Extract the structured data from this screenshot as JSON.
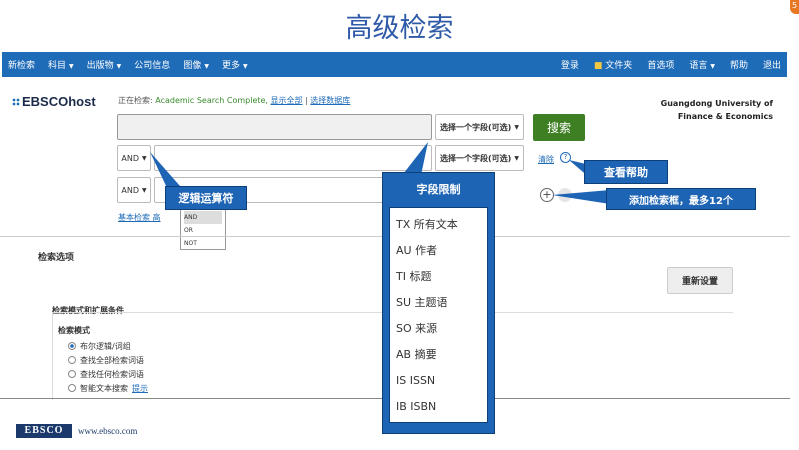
{
  "slide": {
    "title": "高级检索",
    "badge": "5"
  },
  "nav": {
    "left": [
      "新检索",
      "科目",
      "出版物",
      "公司信息",
      "图像",
      "更多"
    ],
    "right": [
      "登录",
      "文件夹",
      "首选项",
      "语言",
      "帮助",
      "退出"
    ]
  },
  "header": {
    "logo": "EBSCOhost",
    "searching_label": "正在检索: ",
    "database": "Academic Search Complete,",
    "show_all": "显示全部",
    "choose_db": "选择数据库",
    "org": "Guangdong University of Finance & Economics"
  },
  "search": {
    "row1_field": "选择一个字段(可选)",
    "row2_bool": "AND",
    "row2_field": "选择一个字段(可选)",
    "row3_bool": "AND",
    "search_button": "搜索",
    "clear": "清除",
    "help": "?",
    "links": "基本检索   高"
  },
  "bool_popup": [
    "AND",
    "OR",
    "NOT"
  ],
  "options": {
    "title": "检索选项",
    "reset": "重新设置",
    "mode_title": "检索模式和扩展条件",
    "mode_sub": "检索模式",
    "modes": [
      "布尔逻辑/词组",
      "查找全部检索词语",
      "查找任何检索词语",
      "智能文本搜索"
    ],
    "mode_hint": "提示"
  },
  "callouts": {
    "logic": "逻辑运算符",
    "field_title": "字段限制",
    "fields": [
      "TX 所有文本",
      "AU 作者",
      "TI 标题",
      "SU 主题语",
      "SO 来源",
      "AB 摘要",
      "IS ISSN",
      "IB ISBN"
    ],
    "help": "查看帮助",
    "add": "添加检索框，最多12个"
  },
  "footer": {
    "logo": "EBSCO",
    "url": "www.ebsco.com"
  }
}
